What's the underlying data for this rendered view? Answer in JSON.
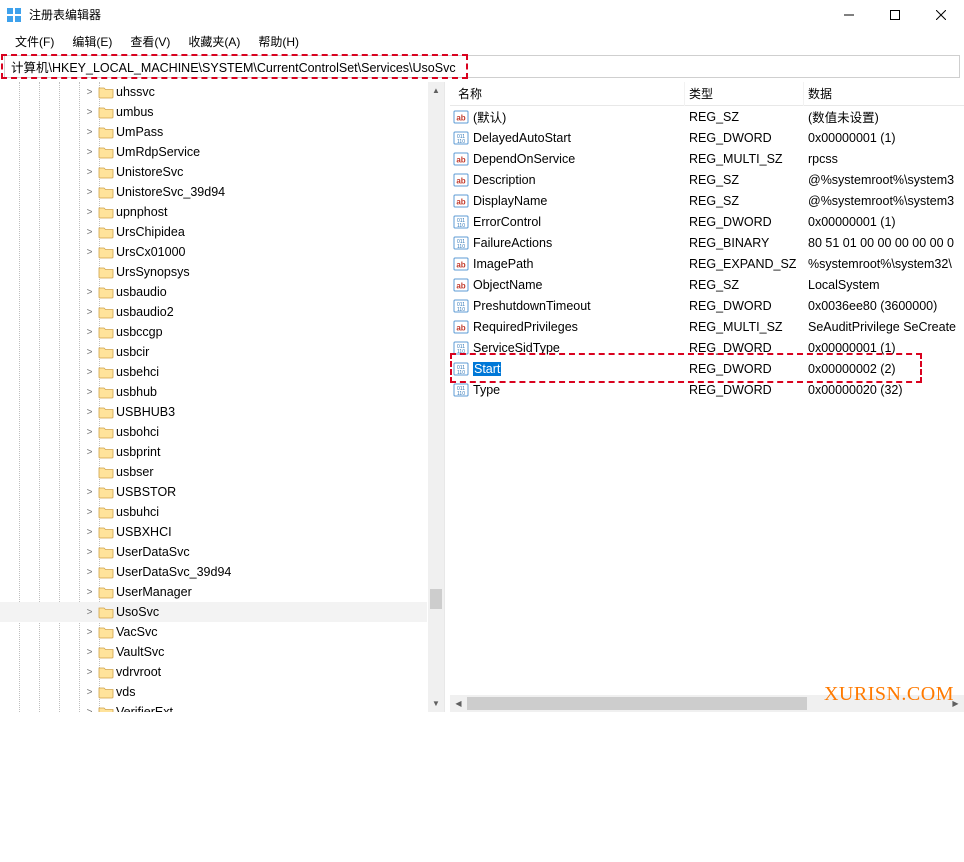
{
  "window": {
    "title": "注册表编辑器"
  },
  "menu": {
    "file": "文件(F)",
    "edit": "编辑(E)",
    "view": "查看(V)",
    "fav": "收藏夹(A)",
    "help": "帮助(H)"
  },
  "address": {
    "path": "计算机\\HKEY_LOCAL_MACHINE\\SYSTEM\\CurrentControlSet\\Services\\UsoSvc"
  },
  "tree": {
    "items": [
      {
        "label": "uhssvc",
        "expander": ">"
      },
      {
        "label": "umbus",
        "expander": ">"
      },
      {
        "label": "UmPass",
        "expander": ">"
      },
      {
        "label": "UmRdpService",
        "expander": ">"
      },
      {
        "label": "UnistoreSvc",
        "expander": ">"
      },
      {
        "label": "UnistoreSvc_39d94",
        "expander": ">"
      },
      {
        "label": "upnphost",
        "expander": ">"
      },
      {
        "label": "UrsChipidea",
        "expander": ">"
      },
      {
        "label": "UrsCx01000",
        "expander": ">"
      },
      {
        "label": "UrsSynopsys",
        "expander": ""
      },
      {
        "label": "usbaudio",
        "expander": ">"
      },
      {
        "label": "usbaudio2",
        "expander": ">"
      },
      {
        "label": "usbccgp",
        "expander": ">"
      },
      {
        "label": "usbcir",
        "expander": ">"
      },
      {
        "label": "usbehci",
        "expander": ">"
      },
      {
        "label": "usbhub",
        "expander": ">"
      },
      {
        "label": "USBHUB3",
        "expander": ">"
      },
      {
        "label": "usbohci",
        "expander": ">"
      },
      {
        "label": "usbprint",
        "expander": ">"
      },
      {
        "label": "usbser",
        "expander": ""
      },
      {
        "label": "USBSTOR",
        "expander": ">"
      },
      {
        "label": "usbuhci",
        "expander": ">"
      },
      {
        "label": "USBXHCI",
        "expander": ">"
      },
      {
        "label": "UserDataSvc",
        "expander": ">"
      },
      {
        "label": "UserDataSvc_39d94",
        "expander": ">"
      },
      {
        "label": "UserManager",
        "expander": ">"
      },
      {
        "label": "UsoSvc",
        "expander": ">",
        "selected": true
      },
      {
        "label": "VacSvc",
        "expander": ">"
      },
      {
        "label": "VaultSvc",
        "expander": ">"
      },
      {
        "label": "vdrvroot",
        "expander": ">"
      },
      {
        "label": "vds",
        "expander": ">"
      },
      {
        "label": "VerifierExt",
        "expander": ">"
      }
    ]
  },
  "listview": {
    "columns": {
      "name": "名称",
      "type": "类型",
      "data": "数据"
    },
    "rows": [
      {
        "icon": "str",
        "name": "(默认)",
        "type": "REG_SZ",
        "data": "(数值未设置)"
      },
      {
        "icon": "bin",
        "name": "DelayedAutoStart",
        "type": "REG_DWORD",
        "data": "0x00000001 (1)"
      },
      {
        "icon": "str",
        "name": "DependOnService",
        "type": "REG_MULTI_SZ",
        "data": "rpcss"
      },
      {
        "icon": "str",
        "name": "Description",
        "type": "REG_SZ",
        "data": "@%systemroot%\\system3"
      },
      {
        "icon": "str",
        "name": "DisplayName",
        "type": "REG_SZ",
        "data": "@%systemroot%\\system3"
      },
      {
        "icon": "bin",
        "name": "ErrorControl",
        "type": "REG_DWORD",
        "data": "0x00000001 (1)"
      },
      {
        "icon": "bin",
        "name": "FailureActions",
        "type": "REG_BINARY",
        "data": "80 51 01 00 00 00 00 00 0"
      },
      {
        "icon": "str",
        "name": "ImagePath",
        "type": "REG_EXPAND_SZ",
        "data": "%systemroot%\\system32\\"
      },
      {
        "icon": "str",
        "name": "ObjectName",
        "type": "REG_SZ",
        "data": "LocalSystem"
      },
      {
        "icon": "bin",
        "name": "PreshutdownTimeout",
        "type": "REG_DWORD",
        "data": "0x0036ee80 (3600000)"
      },
      {
        "icon": "str",
        "name": "RequiredPrivileges",
        "type": "REG_MULTI_SZ",
        "data": "SeAuditPrivilege SeCreate"
      },
      {
        "icon": "bin",
        "name": "ServiceSidType",
        "type": "REG_DWORD",
        "data": "0x00000001 (1)"
      },
      {
        "icon": "bin",
        "name": "Start",
        "type": "REG_DWORD",
        "data": "0x00000002 (2)",
        "selected": true
      },
      {
        "icon": "bin",
        "name": "Type",
        "type": "REG_DWORD",
        "data": "0x00000020 (32)"
      }
    ]
  },
  "watermark": {
    "text": "XURISN.COM"
  }
}
